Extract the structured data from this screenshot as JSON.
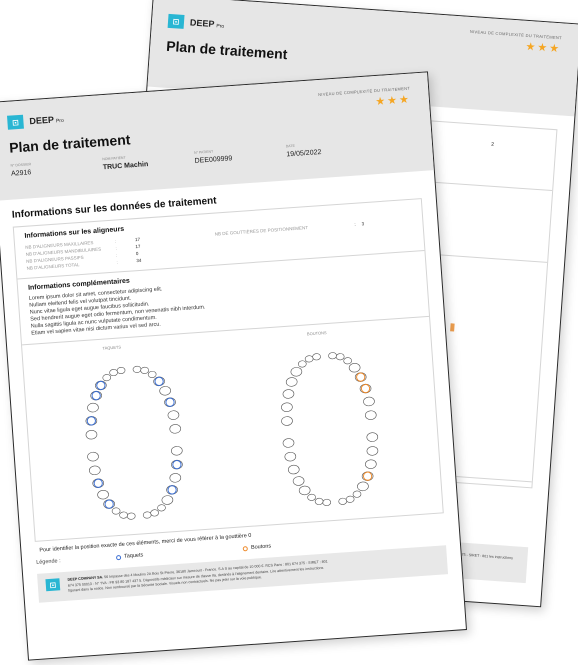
{
  "brand": {
    "name": "DEEP",
    "suffix": "Pro",
    "logo_glyph": "⊡",
    "accent": "#29b6d3"
  },
  "doc": {
    "title": "Plan de traitement",
    "complexity_label": "NIVEAU DE COMPLEXITÉ DU TRAITEMENT",
    "stars": "★★★",
    "star_color": "#f5a623"
  },
  "meta": [
    {
      "key": "N° DOSSIER",
      "value": "A2916"
    },
    {
      "key": "NOM PATIENT",
      "value": "TRUC Machin"
    },
    {
      "key": "N° PATIENT",
      "value": "DEE009999"
    },
    {
      "key": "DATE",
      "value": "19/05/2022"
    }
  ],
  "section_title": "Informations sur les données de traitement",
  "aligners": {
    "title": "Informations sur les aligneurs",
    "rows": [
      {
        "label": "NB D'ALIGNEURS MAXILLAIRES",
        "sep": ":",
        "value": "17"
      },
      {
        "label": "NB D'ALIGNEURS MANDIBULAIRES",
        "sep": ":",
        "value": "17"
      },
      {
        "label": "NB D'ALIGNEURS PASSIFS",
        "sep": ":",
        "value": "0"
      },
      {
        "label": "NB D'ALIGNEURS TOTAL",
        "sep": ":",
        "value": "34"
      }
    ],
    "side": {
      "label": "NB DE GOUTTIÈRES DE POSITIONNEMENT",
      "sep": ":",
      "value": "3"
    }
  },
  "complementary": {
    "title": "Informations complémentaires",
    "lines": [
      "Lorem ipsum dolor sit amet, consectetur adipiscing elit.",
      "Nullam eleifend felis vel volutpat tincidunt.",
      "Nunc vitae ligula eget augue faucibus sollicitudin.",
      "Sed hendrerit augue eget odio fermentum, non venenatis nibh interdum.",
      "Nulla sagittis ligula ac nunc vulputate condimentum.",
      "Etiam vel sapien vitae nisi dictum varius vel sed arcu."
    ]
  },
  "diagrams": {
    "left_label": "TAQUETS",
    "right_label": "BOUTONS"
  },
  "footnote": "Pour identifier la position exacte de ces éléments, merci de vous référer à la gouttière 0",
  "legend": {
    "label": "Légende :",
    "items": [
      {
        "name": "Taquets",
        "color": "#3b6fd4"
      },
      {
        "name": "Boutons",
        "color": "#ee8a2a"
      }
    ]
  },
  "company": {
    "name": "DEEP COMPANY SA.",
    "line1": "56 Impasse des 4 Moulins 2A Bois St-Pierre, 36180 Jamcourt - France. S.A S au capital de 10 000 €. RCS Paris : 801 674 375 - SIRET : 801",
    "line2": "674 375 00013 - N° TVA : FR 93 80 187 437 5. Dispositifs médicaux sur mesure de classe IIa, destinés à l'alignement dentaire. Lire attentivement les instructions",
    "line3": "figurant dans la notice. Non remboursé par la Sécurité Sociale. Visuels non contractuels. Ne pas jeter sur la voie publique."
  },
  "back_sheet": {
    "value": "2",
    "company_snippet": "375 - SIRET : 801 les instructions"
  }
}
